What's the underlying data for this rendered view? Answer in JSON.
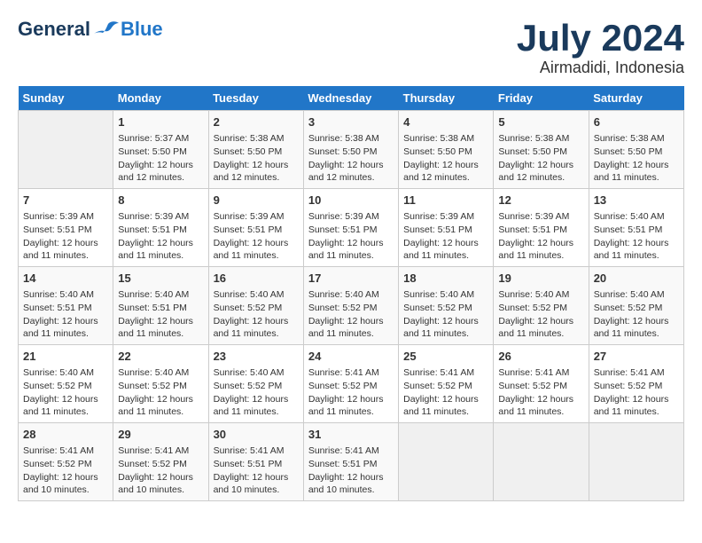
{
  "header": {
    "logo_line1": "General",
    "logo_line2": "Blue",
    "title": "July 2024",
    "subtitle": "Airmadidi, Indonesia"
  },
  "days_of_week": [
    "Sunday",
    "Monday",
    "Tuesday",
    "Wednesday",
    "Thursday",
    "Friday",
    "Saturday"
  ],
  "weeks": [
    [
      {
        "day": "",
        "info": ""
      },
      {
        "day": "1",
        "info": "Sunrise: 5:37 AM\nSunset: 5:50 PM\nDaylight: 12 hours\nand 12 minutes."
      },
      {
        "day": "2",
        "info": "Sunrise: 5:38 AM\nSunset: 5:50 PM\nDaylight: 12 hours\nand 12 minutes."
      },
      {
        "day": "3",
        "info": "Sunrise: 5:38 AM\nSunset: 5:50 PM\nDaylight: 12 hours\nand 12 minutes."
      },
      {
        "day": "4",
        "info": "Sunrise: 5:38 AM\nSunset: 5:50 PM\nDaylight: 12 hours\nand 12 minutes."
      },
      {
        "day": "5",
        "info": "Sunrise: 5:38 AM\nSunset: 5:50 PM\nDaylight: 12 hours\nand 12 minutes."
      },
      {
        "day": "6",
        "info": "Sunrise: 5:38 AM\nSunset: 5:50 PM\nDaylight: 12 hours\nand 11 minutes."
      }
    ],
    [
      {
        "day": "7",
        "info": "Sunrise: 5:39 AM\nSunset: 5:51 PM\nDaylight: 12 hours\nand 11 minutes."
      },
      {
        "day": "8",
        "info": "Sunrise: 5:39 AM\nSunset: 5:51 PM\nDaylight: 12 hours\nand 11 minutes."
      },
      {
        "day": "9",
        "info": "Sunrise: 5:39 AM\nSunset: 5:51 PM\nDaylight: 12 hours\nand 11 minutes."
      },
      {
        "day": "10",
        "info": "Sunrise: 5:39 AM\nSunset: 5:51 PM\nDaylight: 12 hours\nand 11 minutes."
      },
      {
        "day": "11",
        "info": "Sunrise: 5:39 AM\nSunset: 5:51 PM\nDaylight: 12 hours\nand 11 minutes."
      },
      {
        "day": "12",
        "info": "Sunrise: 5:39 AM\nSunset: 5:51 PM\nDaylight: 12 hours\nand 11 minutes."
      },
      {
        "day": "13",
        "info": "Sunrise: 5:40 AM\nSunset: 5:51 PM\nDaylight: 12 hours\nand 11 minutes."
      }
    ],
    [
      {
        "day": "14",
        "info": "Sunrise: 5:40 AM\nSunset: 5:51 PM\nDaylight: 12 hours\nand 11 minutes."
      },
      {
        "day": "15",
        "info": "Sunrise: 5:40 AM\nSunset: 5:51 PM\nDaylight: 12 hours\nand 11 minutes."
      },
      {
        "day": "16",
        "info": "Sunrise: 5:40 AM\nSunset: 5:52 PM\nDaylight: 12 hours\nand 11 minutes."
      },
      {
        "day": "17",
        "info": "Sunrise: 5:40 AM\nSunset: 5:52 PM\nDaylight: 12 hours\nand 11 minutes."
      },
      {
        "day": "18",
        "info": "Sunrise: 5:40 AM\nSunset: 5:52 PM\nDaylight: 12 hours\nand 11 minutes."
      },
      {
        "day": "19",
        "info": "Sunrise: 5:40 AM\nSunset: 5:52 PM\nDaylight: 12 hours\nand 11 minutes."
      },
      {
        "day": "20",
        "info": "Sunrise: 5:40 AM\nSunset: 5:52 PM\nDaylight: 12 hours\nand 11 minutes."
      }
    ],
    [
      {
        "day": "21",
        "info": "Sunrise: 5:40 AM\nSunset: 5:52 PM\nDaylight: 12 hours\nand 11 minutes."
      },
      {
        "day": "22",
        "info": "Sunrise: 5:40 AM\nSunset: 5:52 PM\nDaylight: 12 hours\nand 11 minutes."
      },
      {
        "day": "23",
        "info": "Sunrise: 5:40 AM\nSunset: 5:52 PM\nDaylight: 12 hours\nand 11 minutes."
      },
      {
        "day": "24",
        "info": "Sunrise: 5:41 AM\nSunset: 5:52 PM\nDaylight: 12 hours\nand 11 minutes."
      },
      {
        "day": "25",
        "info": "Sunrise: 5:41 AM\nSunset: 5:52 PM\nDaylight: 12 hours\nand 11 minutes."
      },
      {
        "day": "26",
        "info": "Sunrise: 5:41 AM\nSunset: 5:52 PM\nDaylight: 12 hours\nand 11 minutes."
      },
      {
        "day": "27",
        "info": "Sunrise: 5:41 AM\nSunset: 5:52 PM\nDaylight: 12 hours\nand 11 minutes."
      }
    ],
    [
      {
        "day": "28",
        "info": "Sunrise: 5:41 AM\nSunset: 5:52 PM\nDaylight: 12 hours\nand 10 minutes."
      },
      {
        "day": "29",
        "info": "Sunrise: 5:41 AM\nSunset: 5:52 PM\nDaylight: 12 hours\nand 10 minutes."
      },
      {
        "day": "30",
        "info": "Sunrise: 5:41 AM\nSunset: 5:51 PM\nDaylight: 12 hours\nand 10 minutes."
      },
      {
        "day": "31",
        "info": "Sunrise: 5:41 AM\nSunset: 5:51 PM\nDaylight: 12 hours\nand 10 minutes."
      },
      {
        "day": "",
        "info": ""
      },
      {
        "day": "",
        "info": ""
      },
      {
        "day": "",
        "info": ""
      }
    ]
  ]
}
